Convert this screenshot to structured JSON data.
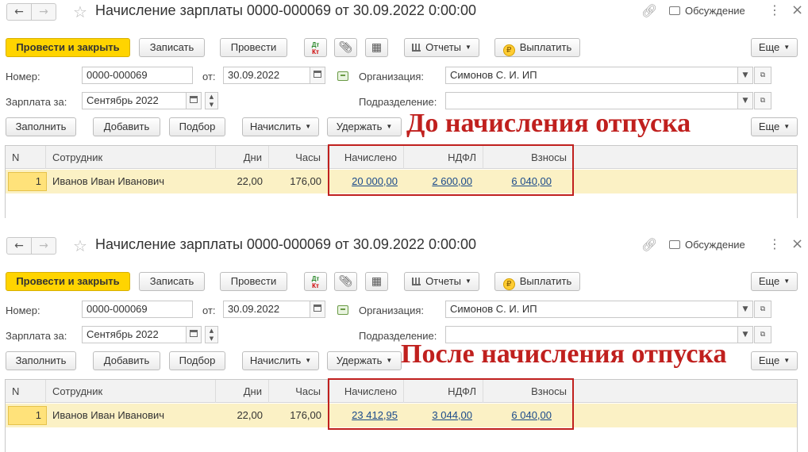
{
  "panels": [
    {
      "title": "Начисление зарплаты 0000-000069 от 30.09.2022 0:00:00",
      "discuss_label": "Обсуждение",
      "toolbar": {
        "post_close": "Провести и закрыть",
        "save": "Записать",
        "post": "Провести",
        "dt": "Дт",
        "kt": "Кт",
        "reports": "Отчеты",
        "pay": "Выплатить",
        "more": "Еще"
      },
      "form": {
        "number_label": "Номер:",
        "number": "0000-000069",
        "date_label": "от:",
        "date": "30.09.2022",
        "org_label": "Организация:",
        "org": "Симонов С. И. ИП",
        "salary_for_label": "Зарплата за:",
        "salary_for": "Сентябрь 2022",
        "dept_label": "Подразделение:",
        "dept": ""
      },
      "table_toolbar": {
        "fill": "Заполнить",
        "add": "Добавить",
        "select": "Подбор",
        "accrue": "Начислить",
        "withhold": "Удержать",
        "more": "Еще"
      },
      "columns": [
        "N",
        "Сотрудник",
        "Дни",
        "Часы",
        "Начислено",
        "НДФЛ",
        "Взносы"
      ],
      "rows": [
        {
          "n": "1",
          "employee": "Иванов Иван Иванович",
          "days": "22,00",
          "hours": "176,00",
          "accrued": "20 000,00",
          "ndfl": "2 600,00",
          "contributions": "6 040,00"
        }
      ],
      "annotation": "До начисления отпуска"
    },
    {
      "title": "Начисление зарплаты 0000-000069 от 30.09.2022 0:00:00",
      "discuss_label": "Обсуждение",
      "toolbar": {
        "post_close": "Провести и закрыть",
        "save": "Записать",
        "post": "Провести",
        "dt": "Дт",
        "kt": "Кт",
        "reports": "Отчеты",
        "pay": "Выплатить",
        "more": "Еще"
      },
      "form": {
        "number_label": "Номер:",
        "number": "0000-000069",
        "date_label": "от:",
        "date": "30.09.2022",
        "org_label": "Организация:",
        "org": "Симонов С. И. ИП",
        "salary_for_label": "Зарплата за:",
        "salary_for": "Сентябрь 2022",
        "dept_label": "Подразделение:",
        "dept": ""
      },
      "table_toolbar": {
        "fill": "Заполнить",
        "add": "Добавить",
        "select": "Подбор",
        "accrue": "Начислить",
        "withhold": "Удержать",
        "more": "Еще"
      },
      "columns": [
        "N",
        "Сотрудник",
        "Дни",
        "Часы",
        "Начислено",
        "НДФЛ",
        "Взносы"
      ],
      "rows": [
        {
          "n": "1",
          "employee": "Иванов Иван Иванович",
          "days": "22,00",
          "hours": "176,00",
          "accrued": "23 412,95",
          "ndfl": "3 044,00",
          "contributions": "6 040,00"
        }
      ],
      "annotation": "После начисления отпуска"
    }
  ],
  "colors": {
    "primary_button": "#ffd400",
    "selected_row": "#fbf1c5",
    "annotation": "#c0201e",
    "link": "#1a4a8a"
  }
}
